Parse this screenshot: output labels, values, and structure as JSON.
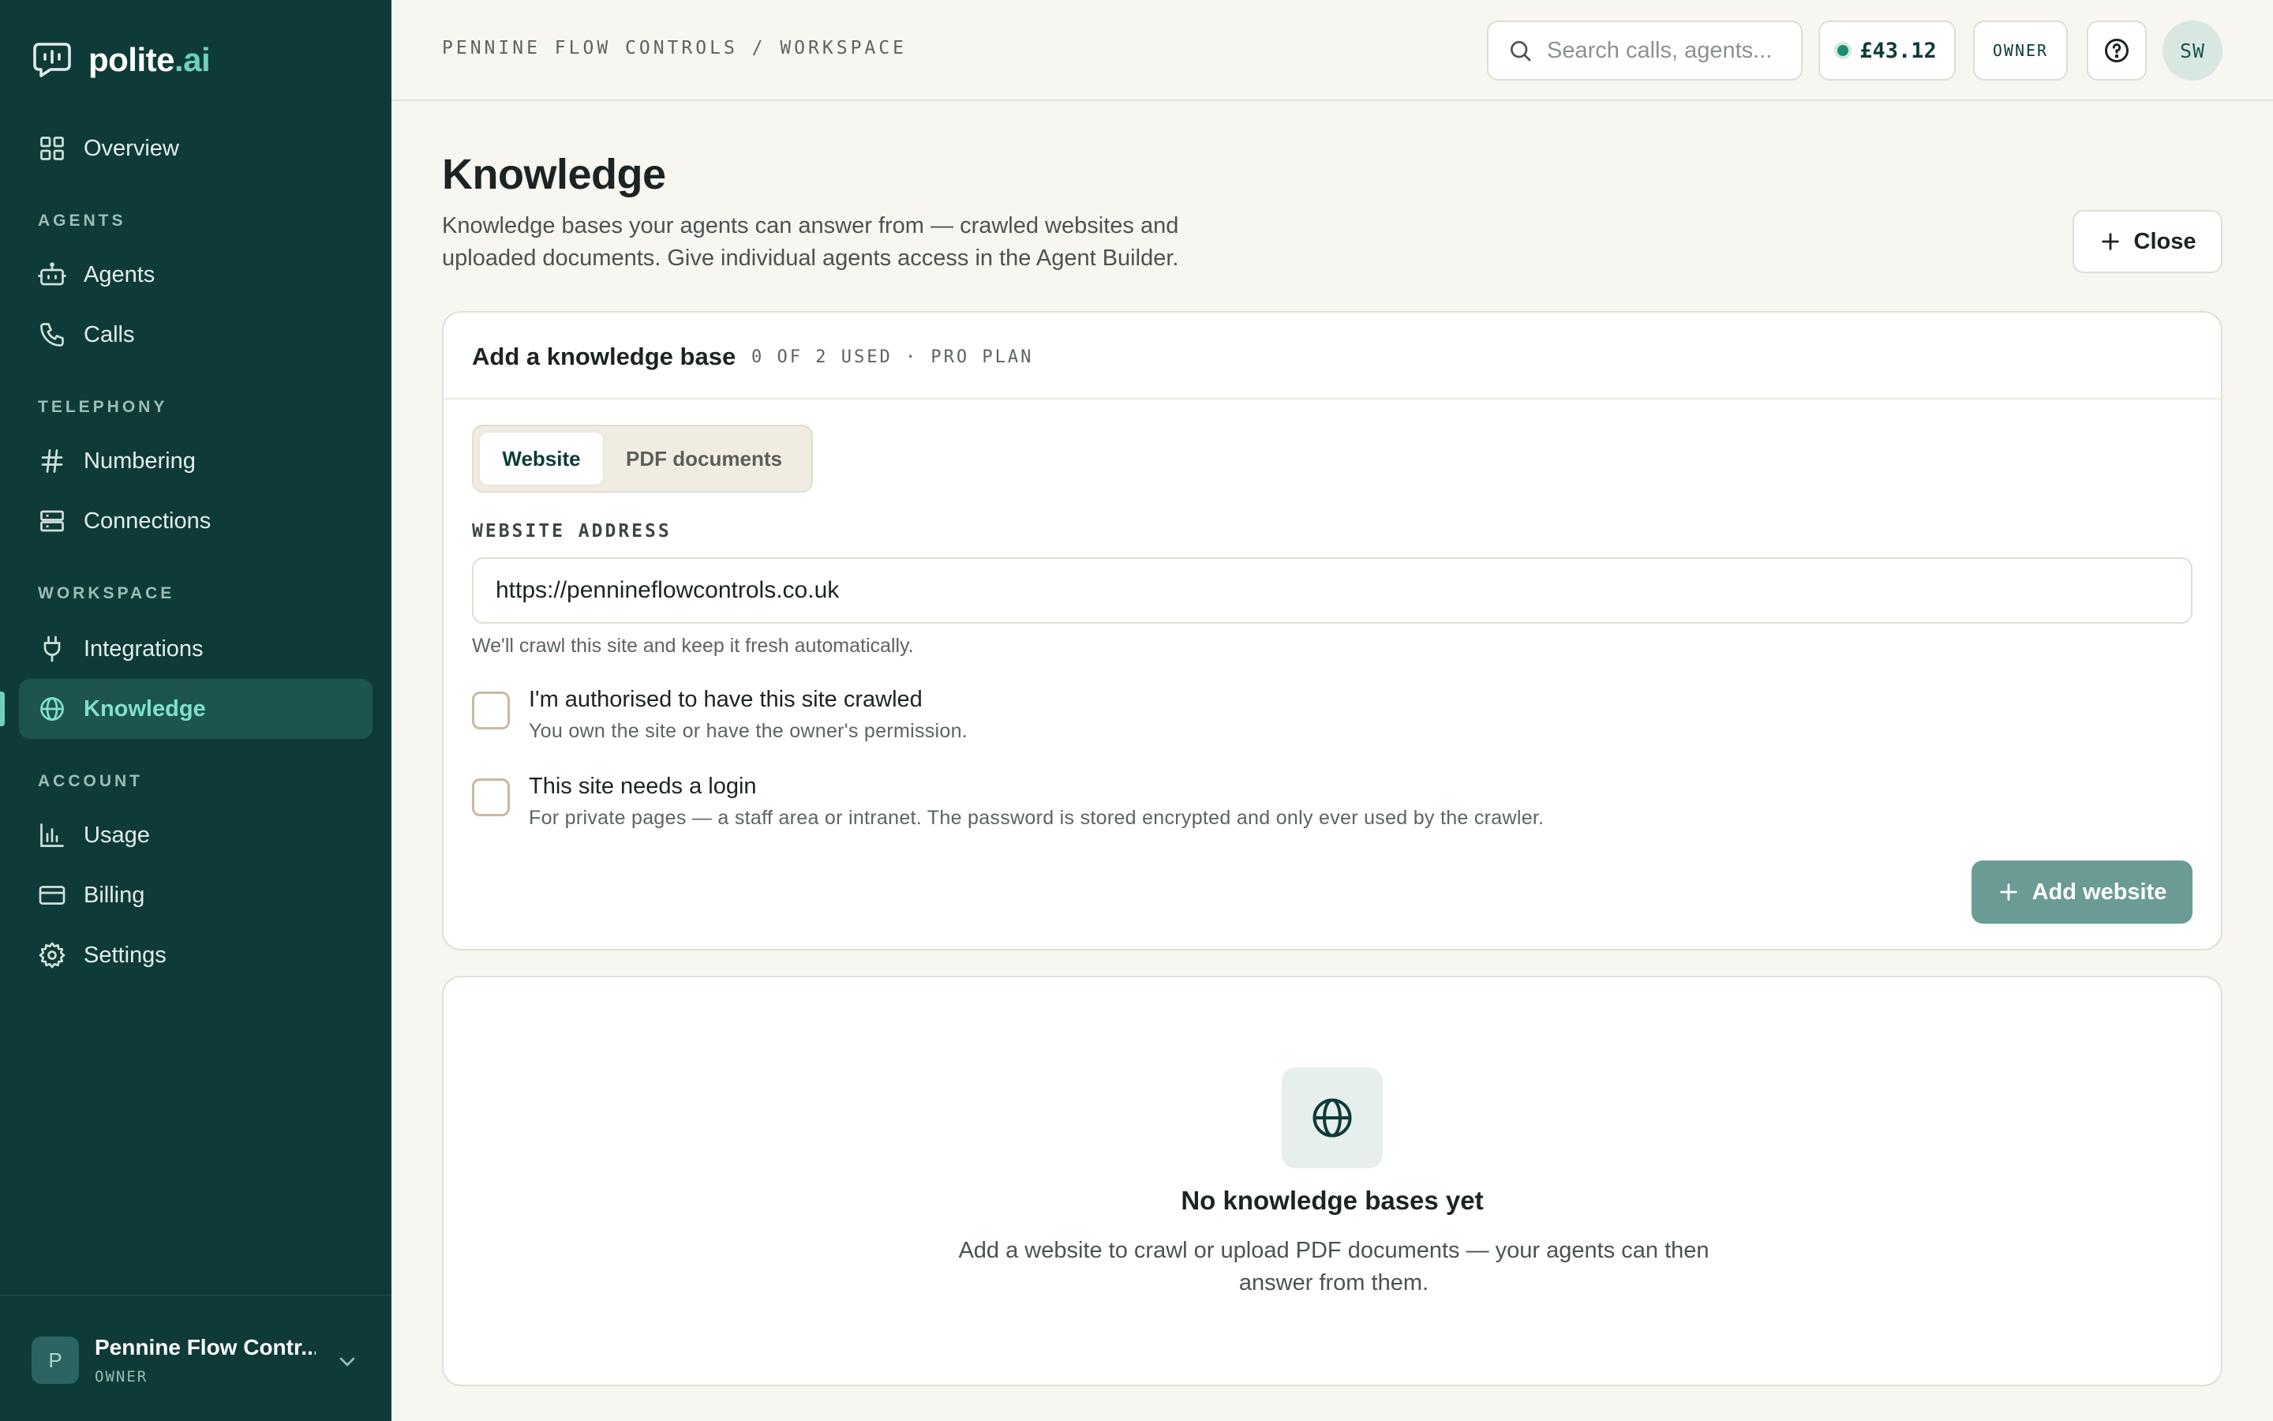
{
  "app": {
    "brand_main": "polite",
    "brand_accent": ".ai"
  },
  "sidebar": {
    "items": [
      {
        "label": "Overview",
        "icon": "grid-icon"
      },
      {
        "label": "Agents",
        "icon": "robot-icon"
      },
      {
        "label": "Calls",
        "icon": "phone-icon"
      },
      {
        "label": "Numbering",
        "icon": "hash-icon"
      },
      {
        "label": "Connections",
        "icon": "server-icon"
      },
      {
        "label": "Integrations",
        "icon": "plug-icon"
      },
      {
        "label": "Knowledge",
        "icon": "globe-icon",
        "active": true
      },
      {
        "label": "Usage",
        "icon": "bar-chart-icon"
      },
      {
        "label": "Billing",
        "icon": "credit-card-icon"
      },
      {
        "label": "Settings",
        "icon": "gear-icon"
      }
    ],
    "sections": [
      "AGENTS",
      "TELEPHONY",
      "WORKSPACE",
      "ACCOUNT"
    ],
    "footer": {
      "avatar_letter": "P",
      "org_name": "Pennine Flow Contr...",
      "org_role": "OWNER"
    }
  },
  "topbar": {
    "breadcrumb": "PENNINE FLOW CONTROLS / WORKSPACE",
    "search_placeholder": "Search calls, agents...",
    "balance": "£43.12",
    "role": "OWNER",
    "user_initials": "SW"
  },
  "page": {
    "title": "Knowledge",
    "description": "Knowledge bases your agents can answer from — crawled websites and uploaded documents. Give individual agents access in the Agent Builder.",
    "close_label": "Close"
  },
  "add_card": {
    "title": "Add a knowledge base",
    "meta": "0 OF 2 USED · PRO PLAN",
    "tabs": [
      "Website",
      "PDF documents"
    ],
    "field_label": "WEBSITE ADDRESS",
    "url_value": "https://pennineflowcontrols.co.uk",
    "helper": "We'll crawl this site and keep it fresh automatically.",
    "check_authorised_title": "I'm authorised to have this site crawled",
    "check_authorised_sub": "You own the site or have the owner's permission.",
    "check_login_title": "This site needs a login",
    "check_login_sub": "For private pages — a staff area or intranet. The password is stored encrypted and only ever used by the crawler.",
    "add_button": "Add website"
  },
  "empty_state": {
    "title": "No knowledge bases yet",
    "description": "Add a website to crawl or upload PDF documents — your agents can then answer from them."
  },
  "colors": {
    "sidebar_bg": "#0e3b38",
    "accent": "#6fd1bd",
    "page_bg": "#f8f6f1",
    "primary_button": "#6b9b95"
  }
}
